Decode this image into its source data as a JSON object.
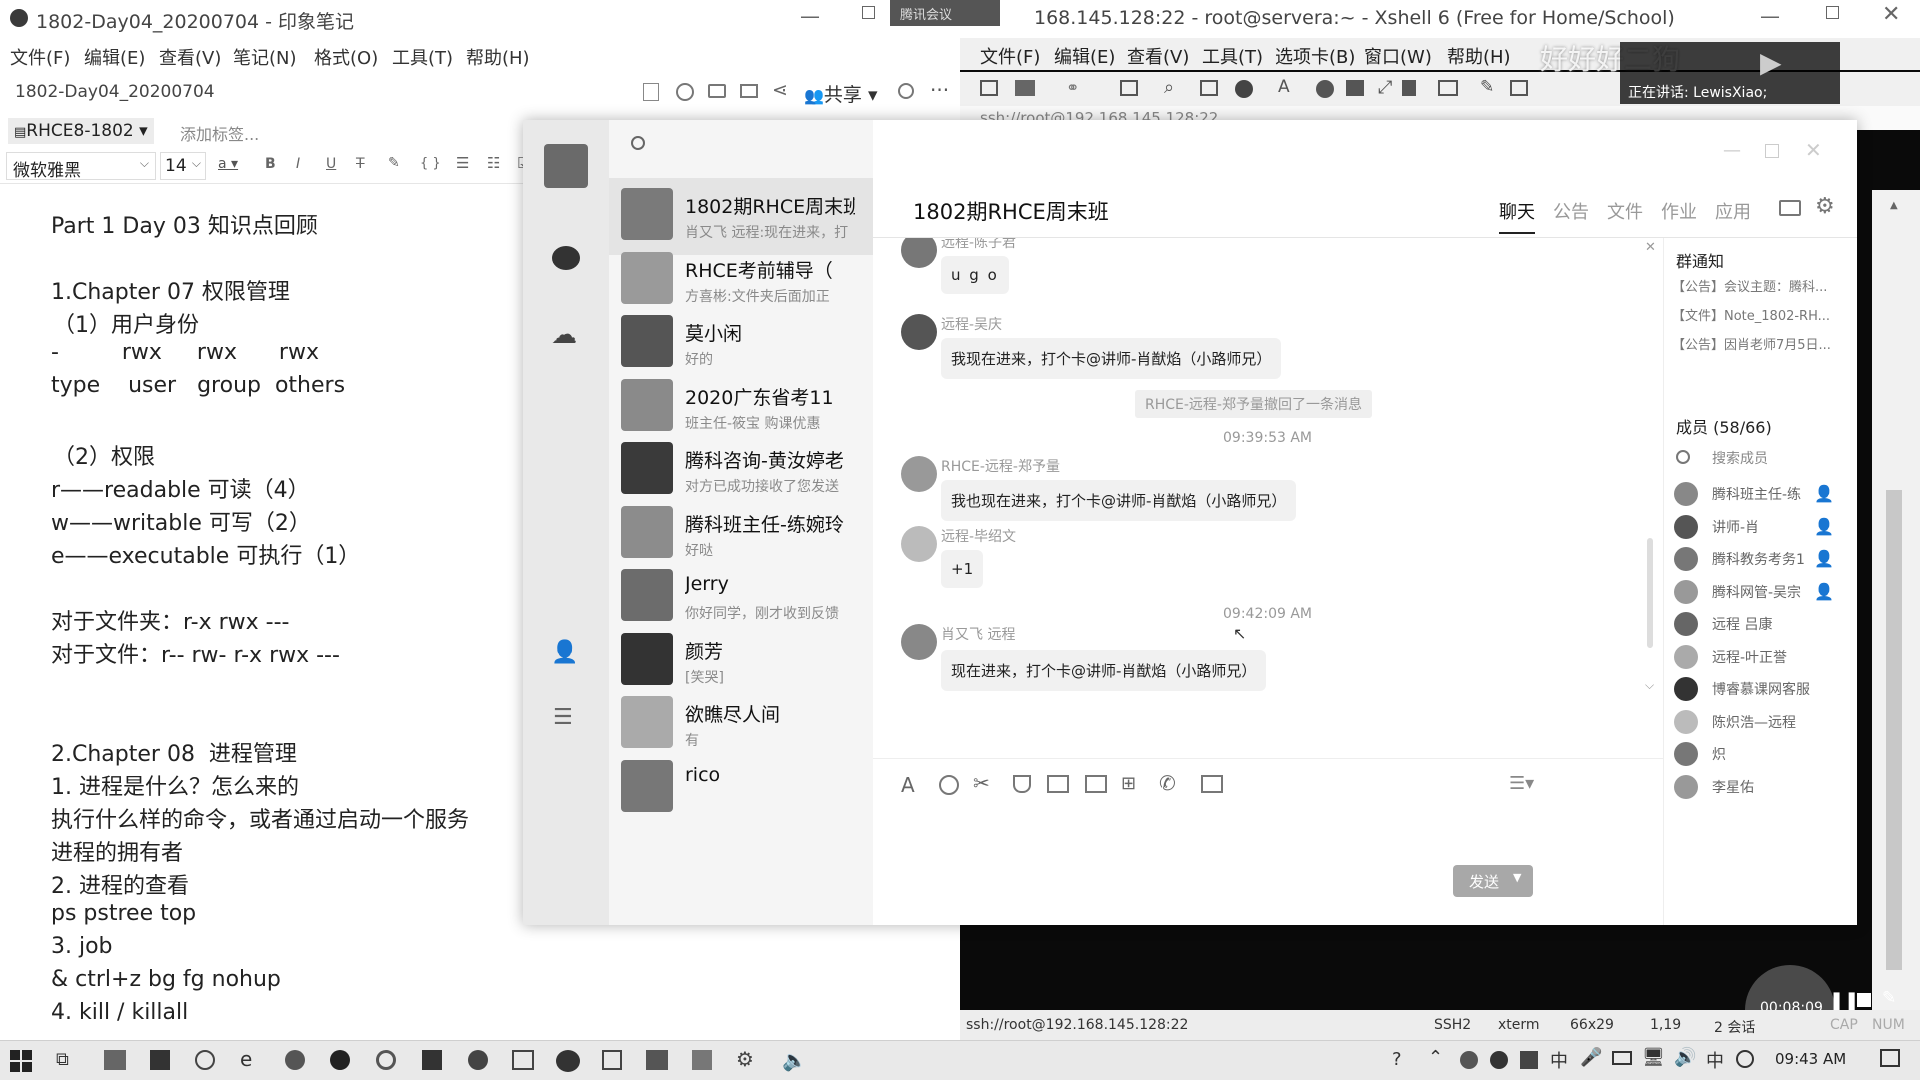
{
  "evernote": {
    "title": "1802-Day04_20200704 - 印象笔记",
    "menu": [
      "文件(F)",
      "编辑(E)",
      "查看(V)",
      "笔记(N)",
      "格式(O)",
      "工具(T)",
      "帮助(H)"
    ],
    "note_name": "1802-Day04_20200704",
    "share_label": "共享",
    "notebook": "RHCE8-1802",
    "add_tag_placeholder": "添加标签...",
    "font_family": "微软雅黑",
    "font_size": "14",
    "body_lines": [
      "Part 1 Day 03 知识点回顾",
      "",
      "1.Chapter 07 权限管理",
      "（1）用户身份",
      "-         rwx     rwx      rwx",
      "type    user   group  others",
      "",
      "（2）权限",
      "r——readable 可读（4）",
      "w——writable 可写（2）",
      "e——executable 可执行（1）",
      "",
      "对于文件夹：r-x rwx ---",
      "对于文件：r-- rw- r-x rwx ---",
      "",
      "",
      "2.Chapter 08  进程管理",
      "1. 进程是什么？怎么来的",
      "执行什么样的命令，或者通过启动一个服务",
      "进程的拥有者",
      "2. 进程的查看",
      "ps pstree top",
      "3. job",
      "& ctrl+z bg fg nohup",
      "4. kill / killall"
    ]
  },
  "xshell": {
    "title": "168.145.128:22 - root@servera:~ - Xshell 6 (Free for Home/School)",
    "menu": [
      "文件(F)",
      "编辑(E)",
      "查看(V)",
      "工具(T)",
      "选项卡(B)",
      "窗口(W)",
      "帮助(H)"
    ],
    "address": "ssh://root@192.168.145.128:22",
    "watermark": "好好好二狗",
    "speaking": "正在讲话: LewisXiao;",
    "meeting_tab": "腾讯会议",
    "status": {
      "conn": "ssh://root@192.168.145.128:22",
      "protocol": "SSH2",
      "term": "xterm",
      "size": "66x29",
      "cursor": "1,19",
      "sessions": "2 会话",
      "caps": "CAP",
      "num": "NUM"
    },
    "recording_time": "00:08:09"
  },
  "qq": {
    "search_icon": "search-icon",
    "conversations": [
      {
        "name": "1802期RHCE周末班",
        "preview": "肖又飞 远程:现在进来，打",
        "color": "#7a7a7a"
      },
      {
        "name": "RHCE考前辅导（",
        "preview": "方喜彬:文件夹后面加正",
        "color": "#9a9a9a"
      },
      {
        "name": "莫小闲",
        "preview": "好的",
        "color": "#555555"
      },
      {
        "name": "2020广东省考11",
        "preview": "班主任-筱宝 购课优惠",
        "color": "#8a8a8a"
      },
      {
        "name": "腾科咨询-黄汝婷老",
        "preview": "对方已成功接收了您发送",
        "color": "#3a3a3a"
      },
      {
        "name": "腾科班主任-练婉玲",
        "preview": "好哒",
        "color": "#8c8c8c"
      },
      {
        "name": "Jerry",
        "preview": "你好同学，刚才收到反馈",
        "color": "#6c6c6c"
      },
      {
        "name": "颜芳",
        "preview": "[笑哭]",
        "color": "#333333"
      },
      {
        "name": "欲瞧尽人间",
        "preview": "有",
        "color": "#aaaaaa"
      },
      {
        "name": "rico",
        "preview": "",
        "color": "#777777"
      }
    ],
    "group_title": "1802期RHCE周末班",
    "tabs": [
      "聊天",
      "公告",
      "文件",
      "作业",
      "应用"
    ],
    "messages": [
      {
        "name": "远程-陈子君",
        "text": "u g o"
      },
      {
        "name": "远程-吴庆",
        "text": "我现在进来，打个卡@讲师-肖猷焰（小路师兄）"
      },
      {
        "name": "RHCE-远程-郑予量",
        "text": "我也现在进来，打个卡@讲师-肖猷焰（小路师兄）"
      },
      {
        "name": "远程-毕绍文",
        "text": "+1"
      },
      {
        "name": "肖又飞 远程",
        "text": "现在进来，打个卡@讲师-肖猷焰（小路师兄）"
      }
    ],
    "recall_notice": "RHCE-远程-郑予量撤回了一条消息",
    "time1": "09:39:53 AM",
    "time2": "09:42:09 AM",
    "send_label": "发送",
    "notice_title": "群通知",
    "notices": [
      "【公告】会议主题：腾科...",
      "【文件】Note_1802-RH...",
      "【公告】因肖老师7月5日..."
    ],
    "members_title": "成员 (58/66)",
    "member_search": "搜索成员",
    "members": [
      "腾科班主任-练",
      "讲师-肖",
      "腾科教务考务1",
      "腾科网管-吴宗",
      "远程 吕康",
      "远程-叶正誉",
      "博睿慕课网客服",
      "陈炽浩—远程",
      "炽",
      "李星佑"
    ]
  },
  "taskbar": {
    "clock": "09:43 AM"
  }
}
